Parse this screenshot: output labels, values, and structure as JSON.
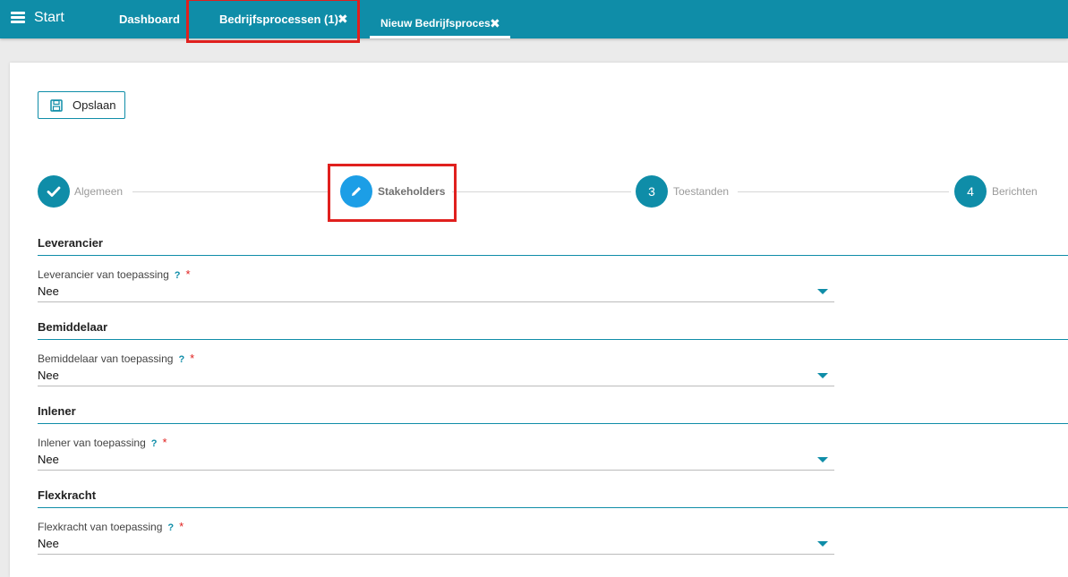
{
  "header": {
    "menu_icon": "hamburger-menu-icon",
    "start_label": "Start",
    "tabs": [
      {
        "label": "Dashboard"
      },
      {
        "label": "Bedrijfsprocessen (1)",
        "close": "✖"
      },
      {
        "label": "Nieuw Bedrijfsproces",
        "close": "✖"
      }
    ],
    "accent_color": "#0f8da8"
  },
  "toolbar": {
    "save_label": "Opslaan",
    "save_icon": "floppy-disk-icon"
  },
  "stepper": {
    "steps": [
      {
        "number": "",
        "label": "Algemeen",
        "state": "completed"
      },
      {
        "number": "",
        "label": "Stakeholders",
        "state": "active"
      },
      {
        "number": "3",
        "label": "Toestanden",
        "state": "pending"
      },
      {
        "number": "4",
        "label": "Berichten",
        "state": "pending"
      }
    ]
  },
  "sections": [
    {
      "title": "Leverancier",
      "field_label": "Leverancier van toepassing",
      "help": "?",
      "required": "*",
      "value": "Nee"
    },
    {
      "title": "Bemiddelaar",
      "field_label": "Bemiddelaar van toepassing",
      "help": "?",
      "required": "*",
      "value": "Nee"
    },
    {
      "title": "Inlener",
      "field_label": "Inlener van toepassing",
      "help": "?",
      "required": "*",
      "value": "Nee"
    },
    {
      "title": "Flexkracht",
      "field_label": "Flexkracht van toepassing",
      "help": "?",
      "required": "*",
      "value": "Nee"
    }
  ],
  "highlight_color": "#e0201e"
}
